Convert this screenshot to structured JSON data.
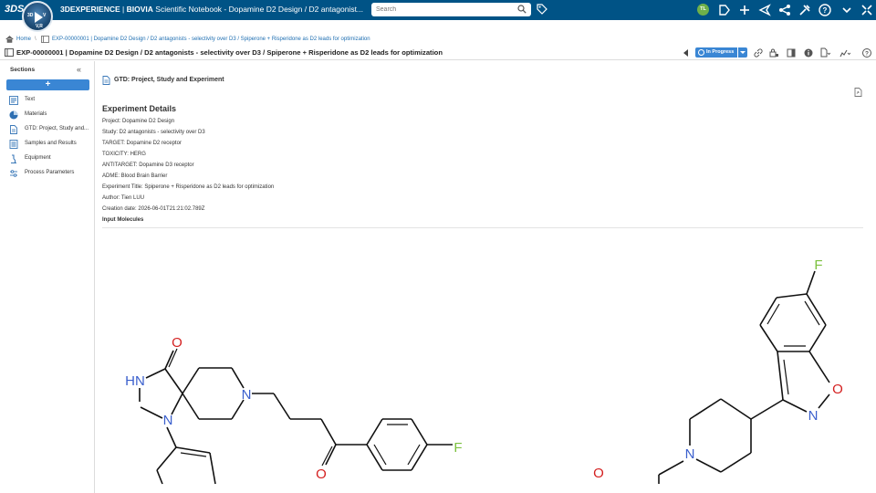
{
  "header": {
    "brand_logo": "3DS",
    "compass_top_left": "3D",
    "compass_top_right": "V",
    "compass_bottom": "V,R",
    "brand_name": "3DEXPERIENCE",
    "platform": "BIOVIA",
    "app_title": "Scientific Notebook - Dopamine D2 Design / D2 antagonist...",
    "search_placeholder": "Search",
    "user_initials": "TL",
    "accent_color": "#005386"
  },
  "breadcrumb": {
    "home": "Home",
    "separator": "\\",
    "experiment": "EXP-00000001 | Dopamine D2 Design / D2 antagonists - selectivity over D3 / Spiperone + Risperidone as D2 leads for optimization"
  },
  "titlebar": {
    "title": "EXP-00000001 | Dopamine D2 Design / D2 antagonists - selectivity over D3 / Spiperone + Risperidone as D2 leads for optimization",
    "status": "In Progress",
    "status_color": "#3a86d4"
  },
  "sidebar": {
    "heading": "Sections",
    "collapse_glyph": "«",
    "add_label": "+",
    "items": [
      {
        "label": "Text",
        "icon": "text-icon"
      },
      {
        "label": "Materials",
        "icon": "materials-icon"
      },
      {
        "label": "GTD: Project, Study and...",
        "icon": "document-icon"
      },
      {
        "label": "Samples and Results",
        "icon": "samples-icon"
      },
      {
        "label": "Equipment",
        "icon": "microscope-icon"
      },
      {
        "label": "Process Parameters",
        "icon": "parameters-icon"
      }
    ]
  },
  "main": {
    "section_title": "GTD: Project, Study and Experiment",
    "experiment_details_heading": "Experiment Details",
    "fields": [
      "Project: Dopamine D2 Design",
      "Study: D2 antagonists - selectivity over D3",
      "TARGET: Dopamine D2 receptor",
      "TOXICITY: HERG",
      "ANTITARGET: Dopamine D3 receptor",
      "ADME: Blood Brain Barrier",
      "Experiment Title: Spiperone + Risperidone as D2 leads for optimization",
      "Author: Tien LUU",
      "Creation date: 2026-06-01T21:21:02.789Z"
    ],
    "input_molecules_label": "Input Molecules",
    "molecule_atoms": {
      "o1": "O",
      "hn": "HN",
      "n1": "N",
      "n2": "N",
      "o2": "O",
      "f1": "F",
      "f2": "F",
      "o3": "O",
      "n3": "N",
      "n4": "N",
      "o4": "O"
    },
    "atom_colors": {
      "oxygen": "#d42020",
      "nitrogen": "#3a5fcd",
      "fluorine": "#7cc13f"
    }
  }
}
